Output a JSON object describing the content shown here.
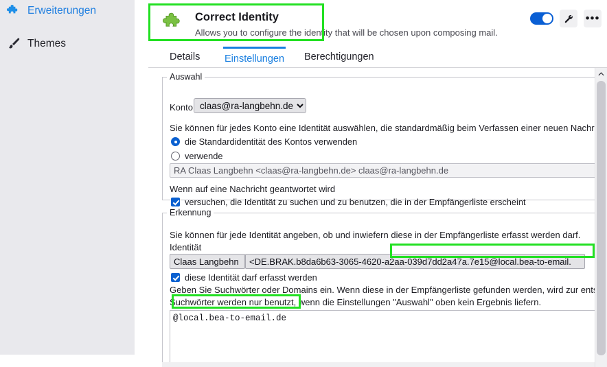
{
  "sidebar": {
    "items": [
      {
        "label": "Erweiterungen",
        "icon": "puzzle-icon",
        "active": true
      },
      {
        "label": "Themes",
        "icon": "brush-icon",
        "active": false
      }
    ]
  },
  "header": {
    "addon_icon": "puzzle-icon",
    "title": "Correct Identity",
    "description": "Allows you to configure the identity that will be chosen upon composing mail.",
    "toggle_state": "on",
    "wrench_icon": "wrench-icon",
    "more_icon": "more-dots-icon",
    "accent_color": "#0a5fd4"
  },
  "tabs": [
    {
      "label": "Details",
      "active": false
    },
    {
      "label": "Einstellungen",
      "active": true
    },
    {
      "label": "Berechtigungen",
      "active": false
    }
  ],
  "auswahl": {
    "legend": "Auswahl",
    "konto_label": "Konto",
    "konto_value": "claas@ra-langbehn.de",
    "konto_options": [
      "claas@ra-langbehn.de"
    ],
    "intro": "Sie können für jedes Konto eine Identität auswählen, die standardmäßig beim Verfassen einer neuen Nachricht verw",
    "radio_default": "die Standardidentität des Kontos verwenden",
    "radio_use": "verwende",
    "identity_disabled_value": "RA Claas Langbehn <claas@ra-langbehn.de> claas@ra-langbehn.de",
    "reply_label": "Wenn auf eine Nachricht geantwortet wird",
    "reply_checkbox": "versuchen, die Identität zu suchen und zu benutzen, die in der Empfängerliste erscheint"
  },
  "erkennung": {
    "legend": "Erkennung",
    "intro": "Sie können für jede Identität angeben, ob und inwiefern diese in der Empfängerliste erfasst werden darf.",
    "identity_label": "Identität",
    "identity_name": "Claas Langbehn",
    "identity_address": "<DE.BRAK.b8da6b63-3065-4620-a2aa-039d7dd2a47a.7e15@local.bea-to-email.",
    "capture_checkbox": "diese Identität darf erfasst werden",
    "help_line_1": "Geben Sie Suchwörter oder Domains ein. Wenn diese in der Empfängerliste gefunden werden, wird zur entsprecher",
    "help_line_2": "Suchwörter werden nur benutzt, wenn die Einstellungen \"Auswahl\" oben kein Ergebnis liefern.",
    "keywords_value": "@local.bea-to-email.de"
  },
  "highlights": {
    "color": "#22e022",
    "boxes": [
      "title-box",
      "identity-address-box",
      "keywords-box"
    ]
  },
  "scrollbar": {
    "up_arrow_icon": "chevron-up-icon"
  }
}
